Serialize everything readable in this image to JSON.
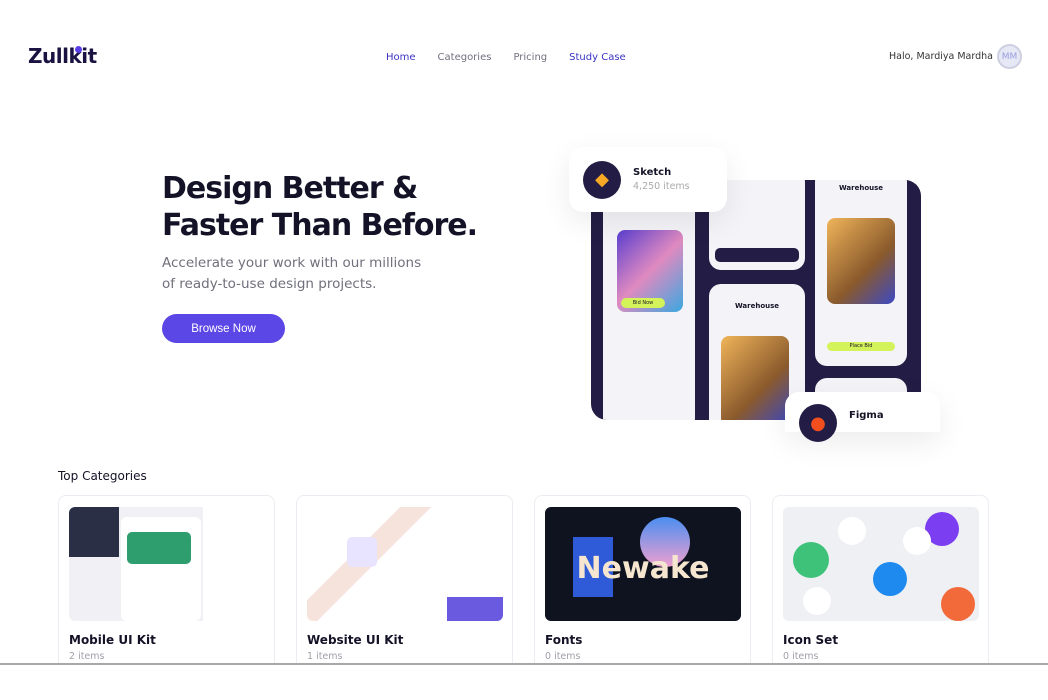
{
  "brand": {
    "logo": "Zullkit",
    "accent": "#5b46e6"
  },
  "nav": {
    "items": [
      {
        "label": "Home"
      },
      {
        "label": "Categories"
      },
      {
        "label": "Pricing"
      },
      {
        "label": "Study Case"
      }
    ]
  },
  "user": {
    "greeting": "Halo, Mardiya Mardha",
    "initials": "MM"
  },
  "hero": {
    "title_line1": "Design Better &",
    "title_line2": "Faster Than Before.",
    "subtitle_line1": "Accelerate your work with our millions",
    "subtitle_line2": "of ready-to-use design projects.",
    "cta": "Browse Now"
  },
  "floats": {
    "sketch": {
      "title": "Sketch",
      "count": "4,250 items"
    },
    "figma": {
      "title": "Figma"
    }
  },
  "mockup": {
    "warehouse": "Warehouse",
    "place_bid": "Place Bid",
    "bid_now": "Bid Now"
  },
  "categories": {
    "title": "Top Categories",
    "items": [
      {
        "name": "Mobile UI Kit",
        "count": "2 items"
      },
      {
        "name": "Website UI Kit",
        "count": "1 items"
      },
      {
        "name": "Fonts",
        "count": "0 items",
        "art_text": "Newake"
      },
      {
        "name": "Icon Set",
        "count": "0 items"
      }
    ]
  }
}
